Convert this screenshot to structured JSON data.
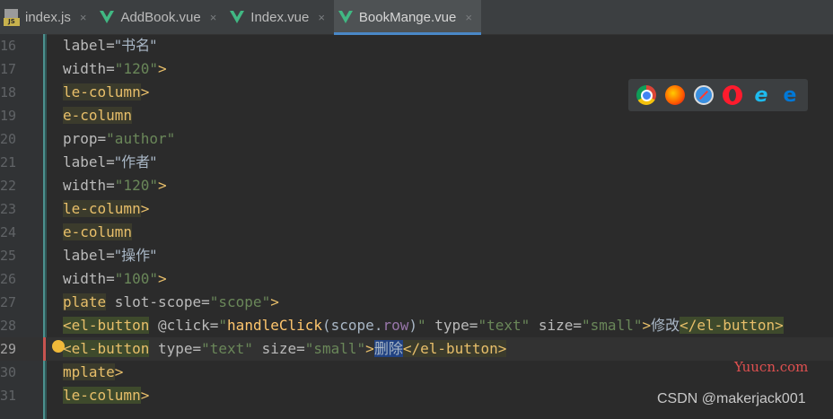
{
  "tabs": [
    {
      "label": "index.js",
      "icon": "js-file-icon",
      "active": false
    },
    {
      "label": "AddBook.vue",
      "icon": "vue-file-icon",
      "active": false
    },
    {
      "label": "Index.vue",
      "icon": "vue-file-icon",
      "active": false
    },
    {
      "label": "BookMange.vue",
      "icon": "vue-file-icon",
      "active": true
    }
  ],
  "close_glyph": "×",
  "line_numbers": [
    "16",
    "17",
    "18",
    "19",
    "20",
    "21",
    "22",
    "23",
    "24",
    "25",
    "26",
    "27",
    "28",
    "29",
    "30",
    "31"
  ],
  "code": {
    "l16": {
      "attr": "label=",
      "str": "\"书名\""
    },
    "l17": {
      "attr": "width=",
      "str": "\"120\"",
      "end": ">"
    },
    "l18": {
      "tag": "le-column",
      "end": ">"
    },
    "l19": {
      "tag": "e-column"
    },
    "l20": {
      "attr": "prop=",
      "str": "\"author\""
    },
    "l21": {
      "attr": "label=",
      "str": "\"作者\""
    },
    "l22": {
      "attr": "width=",
      "str": "\"120\"",
      "end": ">"
    },
    "l23": {
      "tag": "le-column",
      "end": ">"
    },
    "l24": {
      "tag": "e-column"
    },
    "l25": {
      "attr": "label=",
      "str": "\"操作\""
    },
    "l26": {
      "attr": "width=",
      "str": "\"100\"",
      "end": ">"
    },
    "l27": {
      "tag": "plate",
      "attr": " slot-scope=",
      "str": "\"scope\"",
      "end": ">"
    },
    "l28": {
      "open": "<",
      "tag": "el-button",
      "attr1": " @click=",
      "q1": "\"",
      "fn": "handleClick",
      "paren_open": "(scope.",
      "prop": "row",
      "paren_close": ")",
      "q2": "\"",
      "attr2": " type=",
      "str2": "\"text\"",
      "attr3": " size=",
      "str3": "\"small\"",
      "gt": ">",
      "text": "修改",
      "close_open": "</",
      "close_tag": "el-button",
      "close_gt": ">"
    },
    "l29": {
      "open": "<",
      "tag": "el-button",
      "attr2": " type=",
      "str2": "\"text\"",
      "attr3": " size=",
      "str3": "\"small\"",
      "gt": ">",
      "text": "删除",
      "close_open": "</",
      "close_tag": "el-button",
      "close_gt": ">"
    },
    "l30": {
      "tag": "mplate",
      "end": ">"
    },
    "l31": {
      "tag": "le-column",
      "end": ">"
    }
  },
  "browser_icons": [
    "chrome-icon",
    "firefox-icon",
    "safari-icon",
    "opera-icon",
    "ie-icon",
    "edge-icon"
  ],
  "watermarks": {
    "site": "Yuucn.com",
    "author": "CSDN @makerjack001"
  },
  "colors": {
    "bg": "#2b2b2b",
    "tab_accent": "#4a88c7",
    "string": "#6a8759",
    "tag": "#e8bf6a",
    "attr": "#bababa"
  }
}
